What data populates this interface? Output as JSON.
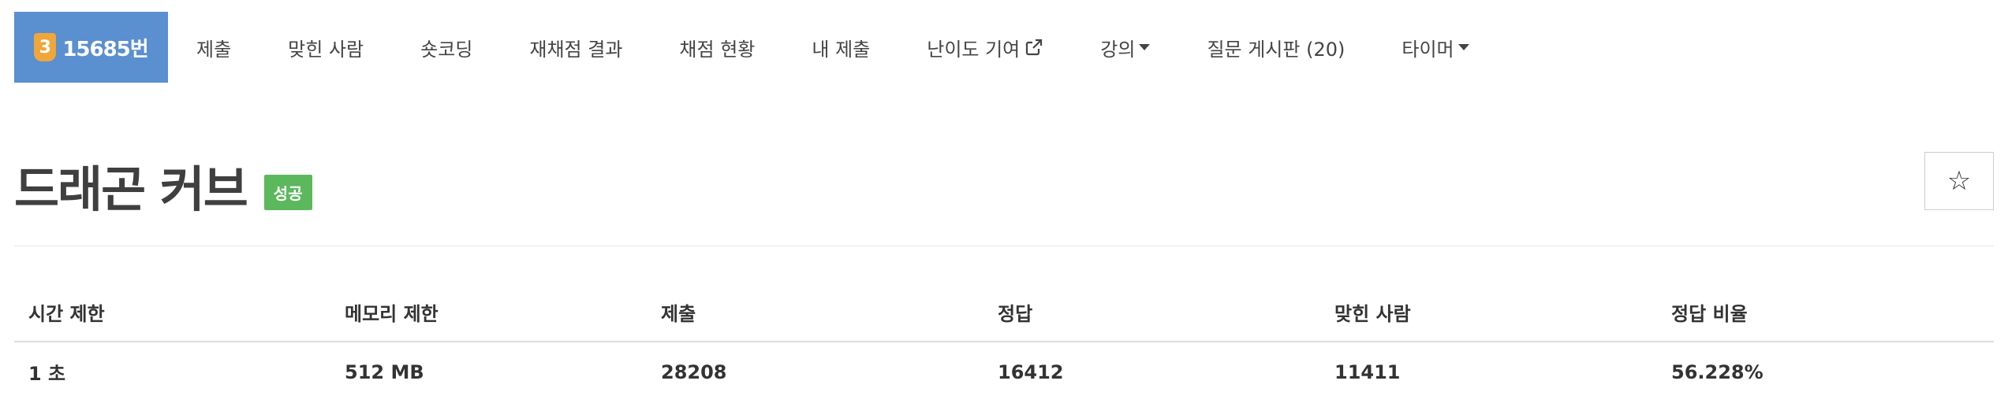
{
  "nav": {
    "brand": {
      "tier": "3",
      "label": "15685번"
    },
    "items": [
      {
        "label": "제출"
      },
      {
        "label": "맞힌 사람"
      },
      {
        "label": "숏코딩"
      },
      {
        "label": "재채점 결과"
      },
      {
        "label": "채점 현황"
      },
      {
        "label": "내 제출"
      },
      {
        "label": "난이도 기여"
      },
      {
        "label": "강의"
      },
      {
        "label": "질문 게시판 (20)"
      },
      {
        "label": "타이머"
      }
    ]
  },
  "problem": {
    "title": "드래곤 커브",
    "status": "성공",
    "star": "☆"
  },
  "info_table": {
    "headers": [
      "시간 제한",
      "메모리 제한",
      "제출",
      "정답",
      "맞힌 사람",
      "정답 비율"
    ],
    "values": [
      "1 초",
      "512 MB",
      "28208",
      "16412",
      "11411",
      "56.228%"
    ]
  },
  "colors": {
    "brand_bg": "#5a8fd0",
    "tier_gold": "#f0a63a",
    "success": "#5cb85c"
  }
}
